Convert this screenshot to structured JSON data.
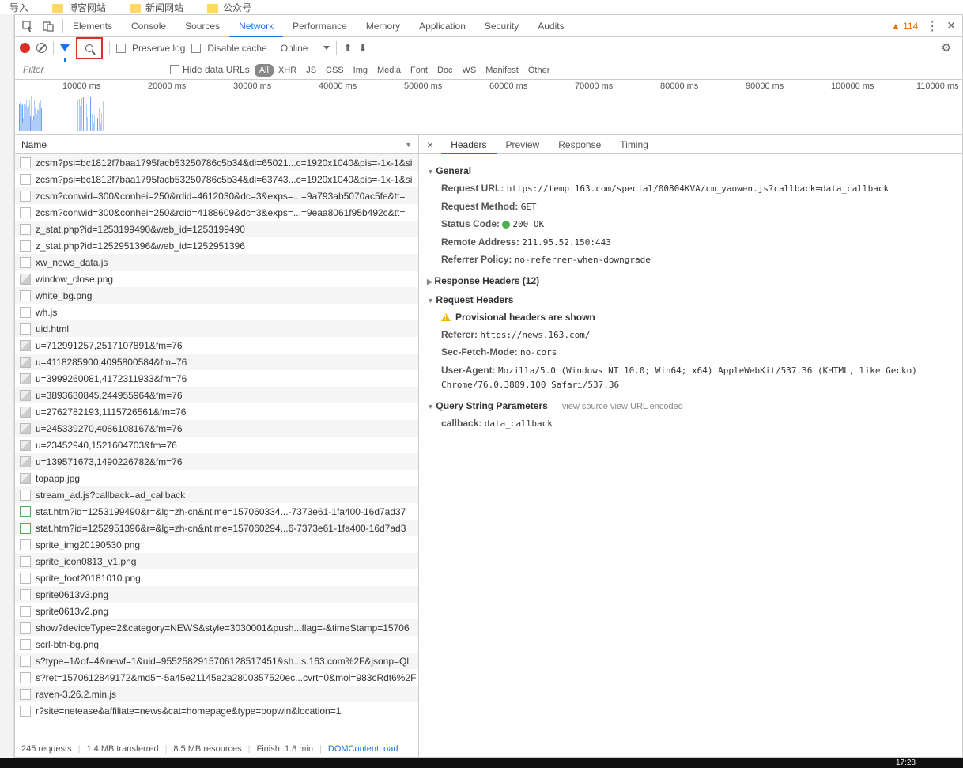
{
  "bookmarks": [
    "导入",
    "博客网站",
    "新闻网站",
    "公众号"
  ],
  "devtoolsTabs": [
    "Elements",
    "Console",
    "Sources",
    "Network",
    "Performance",
    "Memory",
    "Application",
    "Security",
    "Audits"
  ],
  "activeDevtoolsTab": "Network",
  "warnCount": "▲ 114",
  "toolbar": {
    "preserveLog": "Preserve log",
    "disableCache": "Disable cache",
    "online": "Online"
  },
  "filter": {
    "placeholder": "Filter",
    "hideDataUrls": "Hide data URLs",
    "chips": [
      "All",
      "XHR",
      "JS",
      "CSS",
      "Img",
      "Media",
      "Font",
      "Doc",
      "WS",
      "Manifest",
      "Other"
    ]
  },
  "timelineTicks": [
    "10000 ms",
    "20000 ms",
    "30000 ms",
    "40000 ms",
    "50000 ms",
    "60000 ms",
    "70000 ms",
    "80000 ms",
    "90000 ms",
    "100000 ms",
    "110000 ms"
  ],
  "nameHeader": "Name",
  "requests": [
    {
      "t": "doc",
      "n": "zcsm?psi=bc1812f7baa1795facb53250786c5b34&di=65021...c=1920x1040&pis=-1x-1&si"
    },
    {
      "t": "doc",
      "n": "zcsm?psi=bc1812f7baa1795facb53250786c5b34&di=63743...c=1920x1040&pis=-1x-1&si"
    },
    {
      "t": "doc",
      "n": "zcsm?conwid=300&conhei=250&rdid=4612030&dc=3&exps=...=9a793ab5070ac5fe&tt="
    },
    {
      "t": "doc",
      "n": "zcsm?conwid=300&conhei=250&rdid=4188609&dc=3&exps=...=9eaa8061f95b492c&tt="
    },
    {
      "t": "doc",
      "n": "z_stat.php?id=1253199490&web_id=1253199490"
    },
    {
      "t": "doc",
      "n": "z_stat.php?id=1252951396&web_id=1252951396"
    },
    {
      "t": "doc",
      "n": "xw_news_data.js"
    },
    {
      "t": "img",
      "n": "window_close.png"
    },
    {
      "t": "doc",
      "n": "white_bg.png"
    },
    {
      "t": "doc",
      "n": "wh.js"
    },
    {
      "t": "doc",
      "n": "uid.html"
    },
    {
      "t": "img",
      "n": "u=712991257,2517107891&fm=76"
    },
    {
      "t": "img",
      "n": "u=4118285900,4095800584&fm=76"
    },
    {
      "t": "img",
      "n": "u=3999260081,4172311933&fm=76"
    },
    {
      "t": "img",
      "n": "u=3893630845,244955964&fm=76"
    },
    {
      "t": "img",
      "n": "u=2762782193,1115726561&fm=76"
    },
    {
      "t": "img",
      "n": "u=245339270,4086108167&fm=76"
    },
    {
      "t": "img",
      "n": "u=23452940,1521604703&fm=76"
    },
    {
      "t": "img",
      "n": "u=139571673,1490226782&fm=76"
    },
    {
      "t": "img",
      "n": "topapp.jpg"
    },
    {
      "t": "doc",
      "n": "stream_ad.js?callback=ad_callback"
    },
    {
      "t": "grn",
      "n": "stat.htm?id=1253199490&r=&lg=zh-cn&ntime=157060334...-7373e61-1fa400-16d7ad37"
    },
    {
      "t": "grn",
      "n": "stat.htm?id=1252951396&r=&lg=zh-cn&ntime=157060294...6-7373e61-1fa400-16d7ad3"
    },
    {
      "t": "doc",
      "n": "sprite_img20190530.png"
    },
    {
      "t": "doc",
      "n": "sprite_icon0813_v1.png"
    },
    {
      "t": "doc",
      "n": "sprite_foot20181010.png"
    },
    {
      "t": "doc",
      "n": "sprite0613v3.png"
    },
    {
      "t": "doc",
      "n": "sprite0613v2.png"
    },
    {
      "t": "doc",
      "n": "show?deviceType=2&category=NEWS&style=3030001&push...flag=-&timeStamp=15706"
    },
    {
      "t": "doc",
      "n": "scrl-btn-bg.png"
    },
    {
      "t": "doc",
      "n": "s?type=1&of=4&newf=1&uid=9552582915706128517451&sh...s.163.com%2F&jsonp=Ql"
    },
    {
      "t": "doc",
      "n": "s?ret=1570612849172&md5=-5a45e21145e2a2800357520ec...cvrt=0&mol=983cRdt6%2F"
    },
    {
      "t": "doc",
      "n": "raven-3.26.2.min.js"
    },
    {
      "t": "doc",
      "n": "r?site=netease&affiliate=news&cat=homepage&type=popwin&location=1"
    }
  ],
  "statusBar": {
    "requests": "245 requests",
    "transferred": "1.4 MB transferred",
    "resources": "8.5 MB resources",
    "finish": "Finish: 1.8 min",
    "dom": "DOMContentLoad"
  },
  "detailTabs": [
    "Headers",
    "Preview",
    "Response",
    "Timing"
  ],
  "activeDetailTab": "Headers",
  "headers": {
    "generalTitle": "General",
    "general": {
      "url_k": "Request URL:",
      "url_v": "https://temp.163.com/special/00804KVA/cm_yaowen.js?callback=data_callback",
      "method_k": "Request Method:",
      "method_v": "GET",
      "status_k": "Status Code:",
      "status_v": "200 OK",
      "remote_k": "Remote Address:",
      "remote_v": "211.95.52.150:443",
      "ref_k": "Referrer Policy:",
      "ref_v": "no-referrer-when-downgrade"
    },
    "responseTitle": "Response Headers (12)",
    "requestTitle": "Request Headers",
    "provisional": "Provisional headers are shown",
    "req": {
      "ref_k": "Referer:",
      "ref_v": "https://news.163.com/",
      "sfm_k": "Sec-Fetch-Mode:",
      "sfm_v": "no-cors",
      "ua_k": "User-Agent:",
      "ua_v": "Mozilla/5.0 (Windows NT 10.0; Win64; x64) AppleWebKit/537.36 (KHTML, like Gecko) Chrome/76.0.3809.100 Safari/537.36"
    },
    "qspTitle": "Query String Parameters",
    "qspLinks": "view source        view URL encoded",
    "qsp": {
      "cb_k": "callback:",
      "cb_v": "data_callback"
    }
  },
  "clock": "17:28"
}
